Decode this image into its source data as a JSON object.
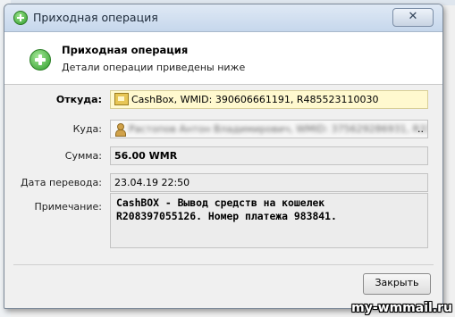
{
  "window": {
    "title": "Приходная операция",
    "close_label": "✕"
  },
  "header": {
    "title": "Приходная операция",
    "subtitle": "Детали операции приведены ниже"
  },
  "fields": {
    "from_label": "Откуда:",
    "from_value": "CashBox, WMID: 390606661191, R485523110030",
    "to_label": "Куда:",
    "to_value": "Растопов Антон Владимирович, WMID: 375629286931, R3362856",
    "to_suffix": "..",
    "amount_label": "Сумма:",
    "amount_value": "56.00 WMR",
    "date_label": "Дата перевода:",
    "date_value": "23.04.19 22:50",
    "note_label": "Примечание:",
    "note_value": "CashBOX - Вывод средств на кошелек\nR208397055126. Номер платежа 983841."
  },
  "buttons": {
    "close": "Закрыть"
  },
  "watermark": "my-wmmail.ru",
  "colors": {
    "highlight_field": "#fff9cf",
    "accent_green": "#2e9d2a"
  }
}
